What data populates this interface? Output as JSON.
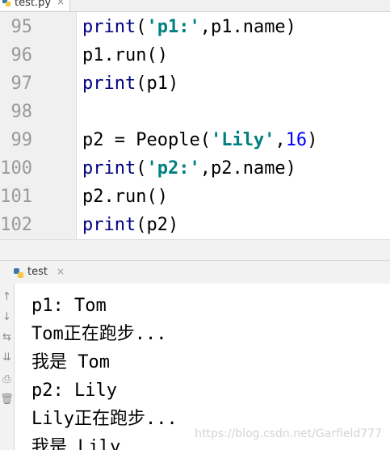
{
  "editor": {
    "file_tab": "test.py",
    "tab_close": "×",
    "lines": [
      {
        "number": "95",
        "parts": [
          {
            "t": "print",
            "c": "kw"
          },
          {
            "t": "(",
            "c": ""
          },
          {
            "t": "'p1:'",
            "c": "str"
          },
          {
            "t": ",p1.name)",
            "c": ""
          }
        ]
      },
      {
        "number": "96",
        "parts": [
          {
            "t": "p1.run()",
            "c": ""
          }
        ]
      },
      {
        "number": "97",
        "parts": [
          {
            "t": "print",
            "c": "kw"
          },
          {
            "t": "(p1)",
            "c": ""
          }
        ]
      },
      {
        "number": "98",
        "parts": []
      },
      {
        "number": "99",
        "parts": [
          {
            "t": "p2 = People(",
            "c": ""
          },
          {
            "t": "'Lily'",
            "c": "str"
          },
          {
            "t": ",",
            "c": ""
          },
          {
            "t": "16",
            "c": "num"
          },
          {
            "t": ")",
            "c": ""
          }
        ]
      },
      {
        "number": "100",
        "parts": [
          {
            "t": "print",
            "c": "kw"
          },
          {
            "t": "(",
            "c": ""
          },
          {
            "t": "'p2:'",
            "c": "str"
          },
          {
            "t": ",p2.name)",
            "c": ""
          }
        ]
      },
      {
        "number": "101",
        "parts": [
          {
            "t": "p2.run()",
            "c": ""
          }
        ]
      },
      {
        "number": "102",
        "parts": [
          {
            "t": "print",
            "c": "kw"
          },
          {
            "t": "(p2)",
            "c": ""
          }
        ]
      }
    ]
  },
  "run_panel": {
    "tab_label": "test",
    "tab_close": "×",
    "toolbar_icons": [
      {
        "name": "rerun-up-icon",
        "glyph": "↑"
      },
      {
        "name": "rerun-down-icon",
        "glyph": "↓"
      },
      {
        "name": "soft-wrap-icon",
        "glyph": "⇆"
      },
      {
        "name": "scroll-to-end-icon",
        "glyph": "⇊"
      },
      {
        "name": "print-icon",
        "glyph": "⎙"
      },
      {
        "name": "trash-icon",
        "glyph": "🗑"
      }
    ],
    "output": [
      "p1: Tom",
      "Tom正在跑步...",
      "我是 Tom",
      "p2: Lily",
      "Lily正在跑步...",
      "我是 Lily"
    ]
  },
  "watermark": "https://blog.csdn.net/Garfield777",
  "colors": {
    "keyword": "#000080",
    "string": "#008080",
    "number": "#0000ff",
    "gutter_bg": "#f0f0f0",
    "line_number": "#999999"
  }
}
